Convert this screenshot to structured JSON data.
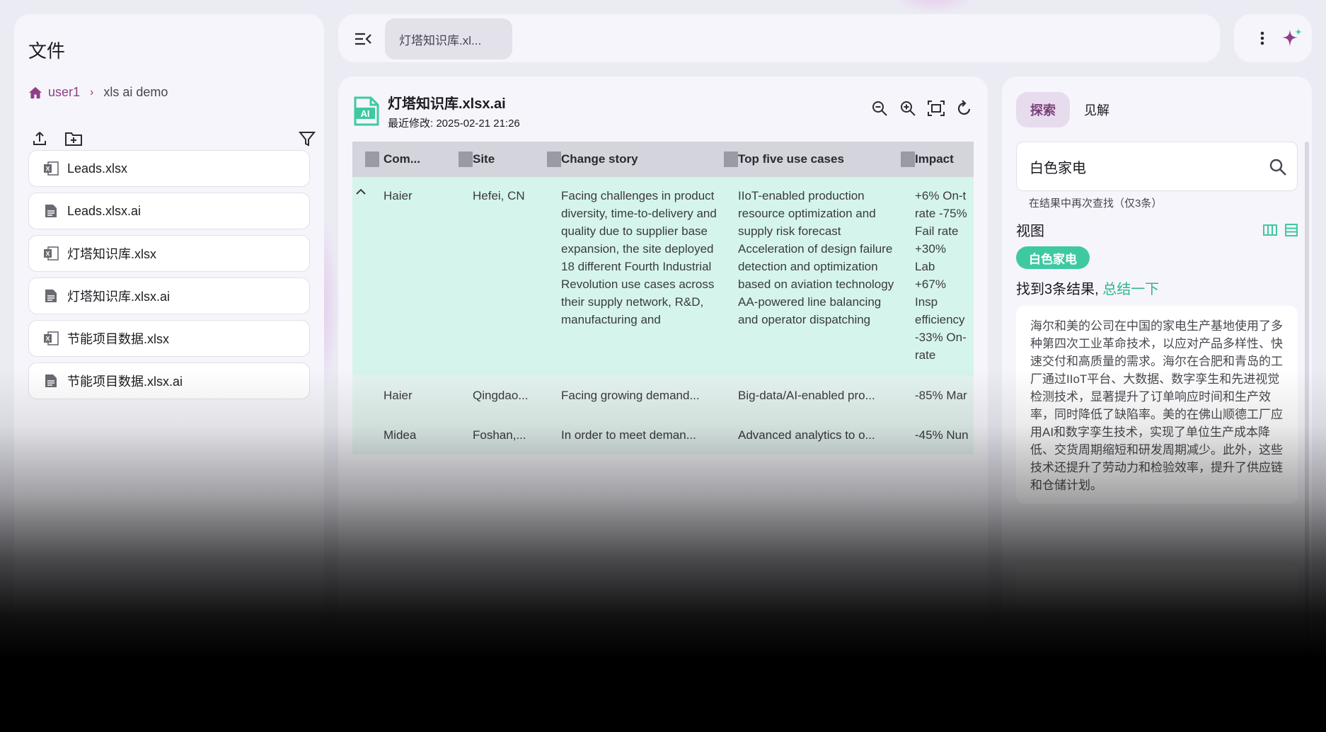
{
  "files_panel": {
    "title": "文件",
    "breadcrumb": {
      "root": "user1",
      "current": "xls ai demo"
    },
    "files": [
      {
        "name": "Leads.xlsx",
        "icon": "excel-file-icon"
      },
      {
        "name": "Leads.xlsx.ai",
        "icon": "doc-file-icon"
      },
      {
        "name": "灯塔知识库.xlsx",
        "icon": "excel-file-icon"
      },
      {
        "name": "灯塔知识库.xlsx.ai",
        "icon": "doc-file-icon"
      },
      {
        "name": "节能项目数据.xlsx",
        "icon": "excel-file-icon"
      },
      {
        "name": "节能项目数据.xlsx.ai",
        "icon": "doc-file-icon"
      }
    ]
  },
  "topbar": {
    "tab_label": "灯塔知识库.xl..."
  },
  "document": {
    "title": "灯塔知识库.xlsx.ai",
    "modified": "最近修改: 2025-02-21 21:26",
    "columns": [
      "Com...",
      "Site",
      "Change story",
      "Top five use cases",
      "Impact"
    ],
    "rows": [
      {
        "company": "Haier",
        "site": "Hefei, CN",
        "change_story": "Facing challenges in product diversity, time-to-delivery and quality due to supplier base expansion, the site deployed 18 different Fourth Industrial Revolution use cases across their supply network, R&D, manufacturing and",
        "use_cases": "IIoT-enabled production resource optimization and supply risk forecast Acceleration of design failure detection and optimization based on aviation technology AA-powered line balancing and operator dispatching",
        "impact": "+6% On-t rate -75% Fail rate +30% Lab +67% Insp efficiency -33% On- rate"
      },
      {
        "company": "Haier",
        "site": "Qingdao...",
        "change_story": "Facing growing demand...",
        "use_cases": "Big-data/AI-enabled pro...",
        "impact": "-85% Mar"
      },
      {
        "company": "Midea",
        "site": "Foshan,...",
        "change_story": "In order to meet deman...",
        "use_cases": "Advanced analytics to o...",
        "impact": "-45% Nun"
      }
    ]
  },
  "insight_panel": {
    "tabs": [
      "探索",
      "见解"
    ],
    "search_value": "白色家电",
    "hint": "在结果中再次查找（仅3条）",
    "view_label": "视图",
    "tag": "白色家电",
    "result_prefix": "找到3条结果, ",
    "result_link": "总结一下",
    "summary": "海尔和美的公司在中国的家电生产基地使用了多种第四次工业革命技术，以应对产品多样性、快速交付和高质量的需求。海尔在合肥和青岛的工厂通过IIoT平台、大数据、数字孪生和先进视觉检测技术，显著提升了订单响应时间和生产效率，同时降低了缺陷率。美的在佛山顺德工厂应用AI和数字孪生技术，实现了单位生产成本降低、交货周期缩短和研发周期减少。此外，这些技术还提升了劳动力和检验效率，提升了供应链和仓储计划。"
  },
  "colors": {
    "accent_purple": "#8e3f86",
    "accent_green": "#3fc9a3",
    "row_highlight": "#d5f4ec"
  }
}
